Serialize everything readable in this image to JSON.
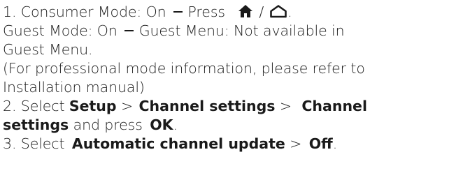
{
  "step1": {
    "consumer_label": "1. Consumer Mode: On",
    "press_label": "Press",
    "home_icon": "home-filled-icon",
    "separator": "/",
    "home_outline_icon": "home-outline-icon",
    "period": ".",
    "guest_label": "Guest Mode: On",
    "guest_menu_line1": "Guest Menu: Not available in",
    "guest_menu_line2": "Guest Menu.",
    "note_line1": "(For professional mode information, please refer to",
    "note_line2": "Installation manual)"
  },
  "step2": {
    "select": "2. Select",
    "setup": "Setup",
    "gt1": ">",
    "channel_settings_1": "Channel",
    "channel_settings_2": "settings",
    "and_press": "and press",
    "ok": "OK",
    "period": "."
  },
  "step3": {
    "select": "3. Select",
    "automatic_update": "Automatic channel update",
    "gt": ">",
    "off": "Off",
    "period": "."
  },
  "step2_mid": {
    "channel_settings": "Channel settings",
    "gt2": ">"
  }
}
